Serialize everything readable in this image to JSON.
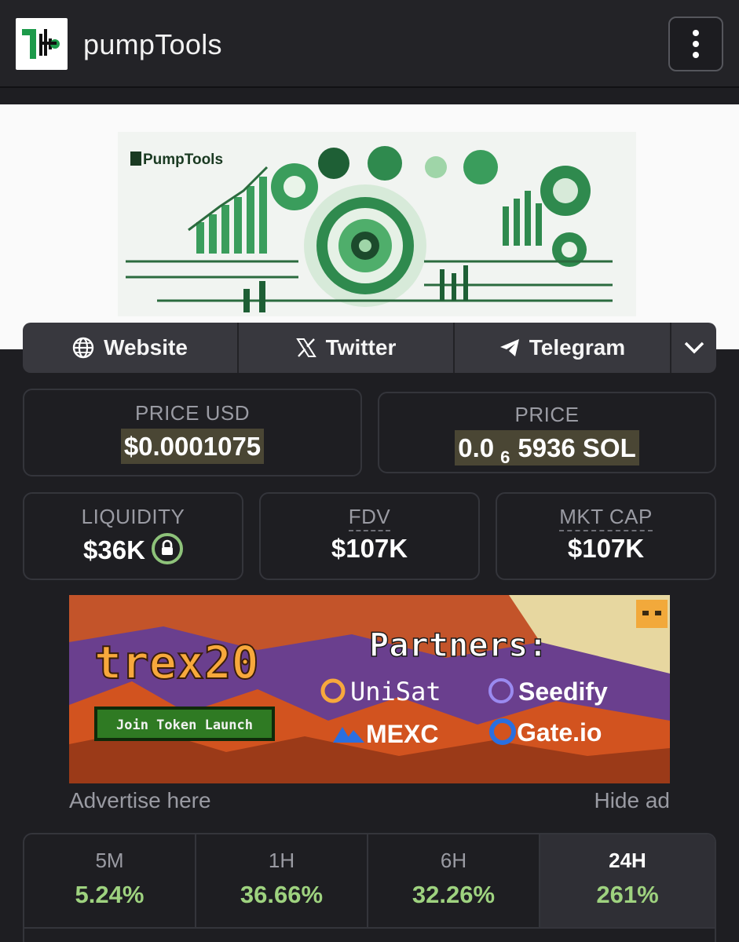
{
  "app": {
    "title": "pumpTools"
  },
  "banner": {
    "brand_text": "PumpTools"
  },
  "links": [
    {
      "label": "Website",
      "icon": "globe-icon"
    },
    {
      "label": "Twitter",
      "icon": "x-icon"
    },
    {
      "label": "Telegram",
      "icon": "telegram-icon"
    }
  ],
  "price_usd": {
    "label": "PRICE USD",
    "value": "$0.0001075"
  },
  "price_sol": {
    "label": "PRICE",
    "prefix": "0.0",
    "subscript": "6",
    "suffix": "5936 SOL"
  },
  "liquidity": {
    "label": "LIQUIDITY",
    "value": "$36K"
  },
  "fdv": {
    "label": "FDV",
    "value": "$107K"
  },
  "mkt_cap": {
    "label": "MKT CAP",
    "value": "$107K"
  },
  "ad": {
    "brand": "trex20",
    "cta": "Join Token Launch",
    "heading": "Partners:",
    "partners": [
      "UniSat",
      "Seedify",
      "MEXC",
      "Gate.io"
    ],
    "advertise_label": "Advertise here",
    "hide_label": "Hide ad"
  },
  "timeframes": [
    {
      "label": "5M",
      "value": "5.24%"
    },
    {
      "label": "1H",
      "value": "36.66%"
    },
    {
      "label": "6H",
      "value": "32.26%"
    },
    {
      "label": "24H",
      "value": "261%"
    }
  ],
  "colors": {
    "accent_green": "#9ed27f",
    "background": "#1e1e22",
    "brand_green": "#1c9a4a"
  }
}
